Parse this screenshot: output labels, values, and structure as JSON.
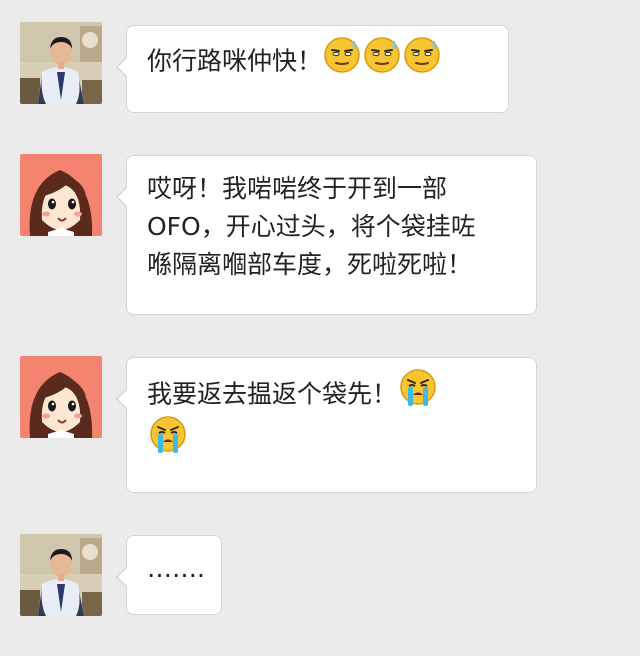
{
  "messages": [
    {
      "sender": "man",
      "text": "你行路咪仲快！",
      "emojis": [
        "sweat-smile-emoji",
        "sweat-smile-emoji",
        "sweat-smile-emoji"
      ]
    },
    {
      "sender": "girl",
      "line1": "哎呀！我啱啱终于开到一部",
      "line2": "OFO，开心过头，将个袋挂咗",
      "line3": "喺隔离嗰部车度，死啦死啦！"
    },
    {
      "sender": "girl",
      "text": "我要返去揾返个袋先！",
      "emojis": [
        "crying-emoji",
        "crying-emoji"
      ]
    },
    {
      "sender": "man",
      "text": "……."
    }
  ],
  "colors": {
    "background": "#ebebeb",
    "bubble": "#ffffff",
    "bubble_border": "#d6d6d6",
    "emoji_face": "#f7c531",
    "tears": "#3fb9e6"
  }
}
